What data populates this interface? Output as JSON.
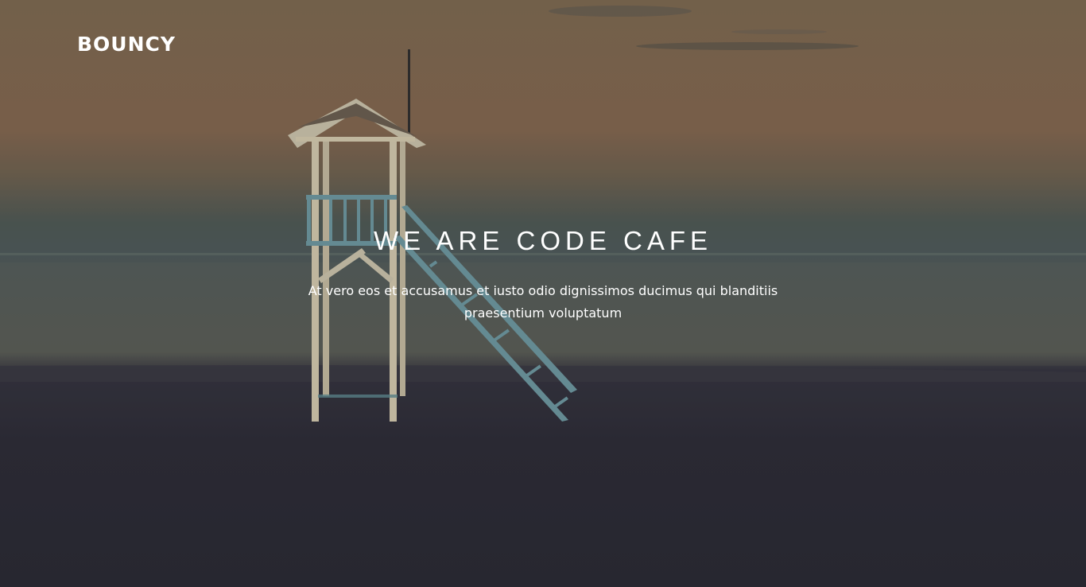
{
  "header": {
    "logo_text": "BOUNCY"
  },
  "hero": {
    "headline": "WE ARE CODE CAFE",
    "subtitle": "At vero eos et accusamus et iusto odio dignissimos ducimus qui blanditiis praesentium voluptatum"
  },
  "colors": {
    "text": "#ffffff",
    "sky_top": "#7f6a50",
    "sea": "#545a57",
    "sand": "#2a2a33",
    "tower_wood": "#d8cdb0",
    "tower_rail": "#6f9aa2"
  }
}
